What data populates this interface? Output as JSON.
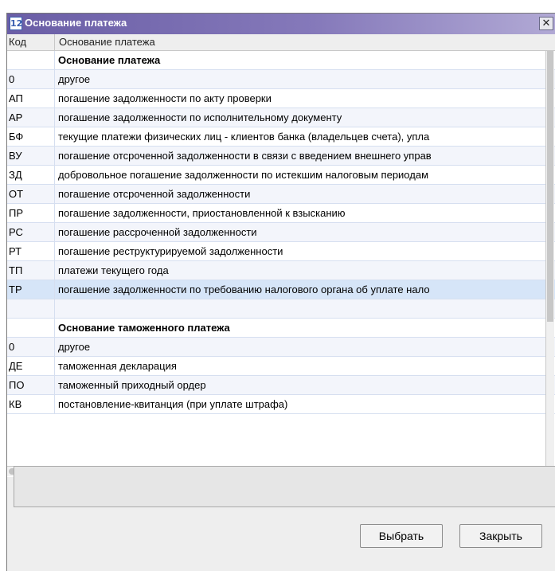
{
  "window": {
    "title": "Основание платежа",
    "app_icon_glyph": "12",
    "close_glyph": "✕"
  },
  "grid": {
    "columns": [
      "Код",
      "Основание платежа"
    ],
    "rows": [
      {
        "code": "",
        "desc": "Основание платежа",
        "type": "section"
      },
      {
        "code": "0",
        "desc": "другое"
      },
      {
        "code": "АП",
        "desc": "погашение задолженности по акту проверки"
      },
      {
        "code": "АР",
        "desc": "погашение задолженности по исполнительному документу"
      },
      {
        "code": "БФ",
        "desc": "текущие платежи физических лиц - клиентов  банка  (владельцев счета), упла"
      },
      {
        "code": "ВУ",
        "desc": "погашение отсроченной задолженности в связи с введением внешнего управ"
      },
      {
        "code": "ЗД",
        "desc": "добровольное погашение задолженности по истекшим налоговым периодам"
      },
      {
        "code": "ОТ",
        "desc": "погашение отсроченной задолженности"
      },
      {
        "code": "ПР",
        "desc": "погашение задолженности, приостановленной к взысканию"
      },
      {
        "code": "РС",
        "desc": "погашение рассроченной задолженности"
      },
      {
        "code": "РТ",
        "desc": "погашение реструктурируемой задолженности"
      },
      {
        "code": "ТП",
        "desc": "платежи текущего года"
      },
      {
        "code": "ТР",
        "desc": "погашение задолженности по требованию налогового органа об уплате нало",
        "selected": true
      },
      {
        "code": "",
        "desc": ""
      },
      {
        "code": "",
        "desc": "Основание таможенного платежа",
        "type": "section"
      },
      {
        "code": "0",
        "desc": "другое"
      },
      {
        "code": "ДЕ",
        "desc": "таможенная декларация"
      },
      {
        "code": "ПО",
        "desc": "таможенный приходный ордер"
      },
      {
        "code": "КВ",
        "desc": "постановление-квитанция (при уплате штрафа)"
      }
    ]
  },
  "buttons": {
    "select": "Выбрать",
    "close": "Закрыть"
  },
  "colors": {
    "title_bar": "#7a6eb4",
    "selected_row": "#d6e5f8",
    "background": "#eeeeee"
  }
}
